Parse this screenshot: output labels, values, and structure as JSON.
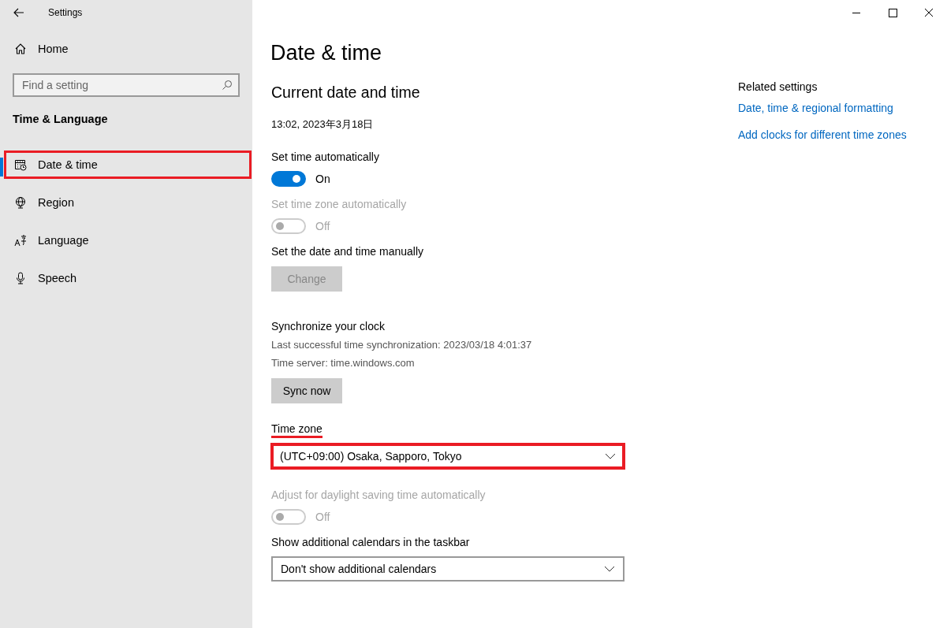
{
  "window": {
    "title": "Settings"
  },
  "sidebar": {
    "home": "Home",
    "search": {
      "placeholder": "Find a setting"
    },
    "section": "Time & Language",
    "items": [
      {
        "label": "Date & time",
        "selected": true,
        "highlighted": true
      },
      {
        "label": "Region",
        "selected": false,
        "highlighted": false
      },
      {
        "label": "Language",
        "selected": false,
        "highlighted": false
      },
      {
        "label": "Speech",
        "selected": false,
        "highlighted": false
      }
    ]
  },
  "page": {
    "title": "Date & time",
    "heading": "Current date and time",
    "datetime": "13:02, 2023年3月18日",
    "settings": [
      {
        "kind": "toggle",
        "label": "Set time automatically",
        "on": true,
        "disabled": false,
        "state_text": "On"
      },
      {
        "kind": "toggle",
        "label": "Set time zone automatically",
        "on": false,
        "disabled": true,
        "state_text": "Off"
      },
      {
        "kind": "button",
        "label": "Set the date and time manually",
        "button": "Change",
        "disabled": true
      },
      {
        "kind": "sync",
        "label": "Synchronize your clock",
        "lines": [
          "Last successful time synchronization: 2023/03/18 4:01:37",
          "Time server: time.windows.com"
        ],
        "button": "Sync now",
        "disabled": false
      },
      {
        "kind": "dropdown",
        "label": "Time zone",
        "value": "(UTC+09:00) Osaka, Sapporo, Tokyo",
        "highlighted": true,
        "underlined": true
      },
      {
        "kind": "toggle",
        "label": "Adjust for daylight saving time automatically",
        "on": false,
        "disabled": true,
        "state_text": "Off"
      },
      {
        "kind": "dropdown",
        "label": "Show additional calendars in the taskbar",
        "value": "Don't show additional calendars",
        "highlighted": false,
        "underlined": false
      }
    ]
  },
  "related": {
    "title": "Related settings",
    "links": [
      "Date, time & regional formatting",
      "Add clocks for different time zones"
    ]
  }
}
